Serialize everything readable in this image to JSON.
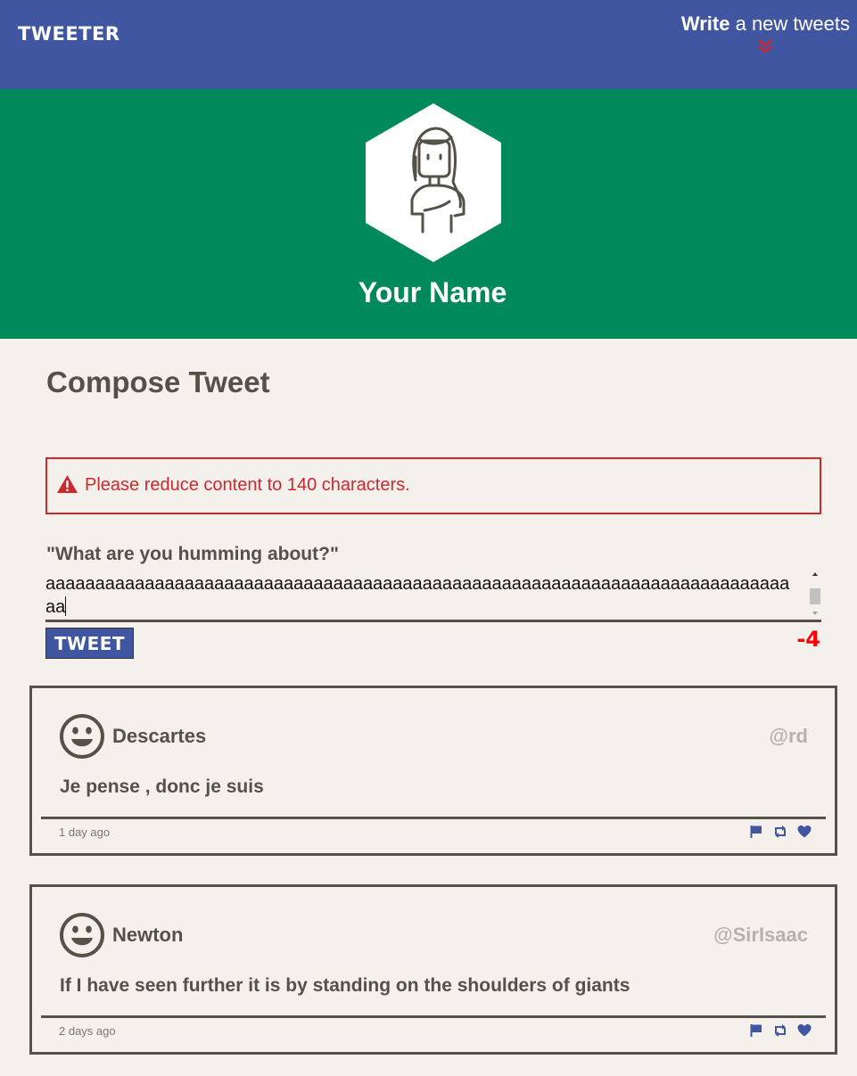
{
  "nav": {
    "brand": "TWEETER",
    "compose_bold": "Write",
    "compose_rest": " a new tweets"
  },
  "profile": {
    "name": "Your Name"
  },
  "compose": {
    "title": "Compose Tweet",
    "error_message": "Please reduce content to 140 characters.",
    "label": "\"What are you humming about?\"",
    "text_value": "aaaaaaaaaaaaaaaaaaaaaaaaaaaaaaaaaaaaaaaaaaaaaaaaaaaaaaaaaaaaaaaaaaaaaaaaaaaaa",
    "submit_label": "TWEET",
    "counter": "-4"
  },
  "tweets": [
    {
      "author": "Descartes",
      "handle": "@rd",
      "content": "Je pense , donc je suis",
      "time": "1 day ago"
    },
    {
      "author": "Newton",
      "handle": "@SirIsaac",
      "content": "If I have seen further it is by standing on the shoulders of giants",
      "time": "2 days ago"
    }
  ],
  "colors": {
    "nav": "#4056a1",
    "profile": "#008a5c",
    "error": "#d0272d",
    "counter_over": "#ff0000",
    "text": "#545149",
    "background": "#f4f1ec"
  },
  "icons": {
    "compose_toggle": "double-chevron-down-icon",
    "error": "warning-triangle-icon",
    "avatar": "smiley-face-icon",
    "actions": [
      "flag-icon",
      "retweet-icon",
      "heart-icon"
    ]
  }
}
